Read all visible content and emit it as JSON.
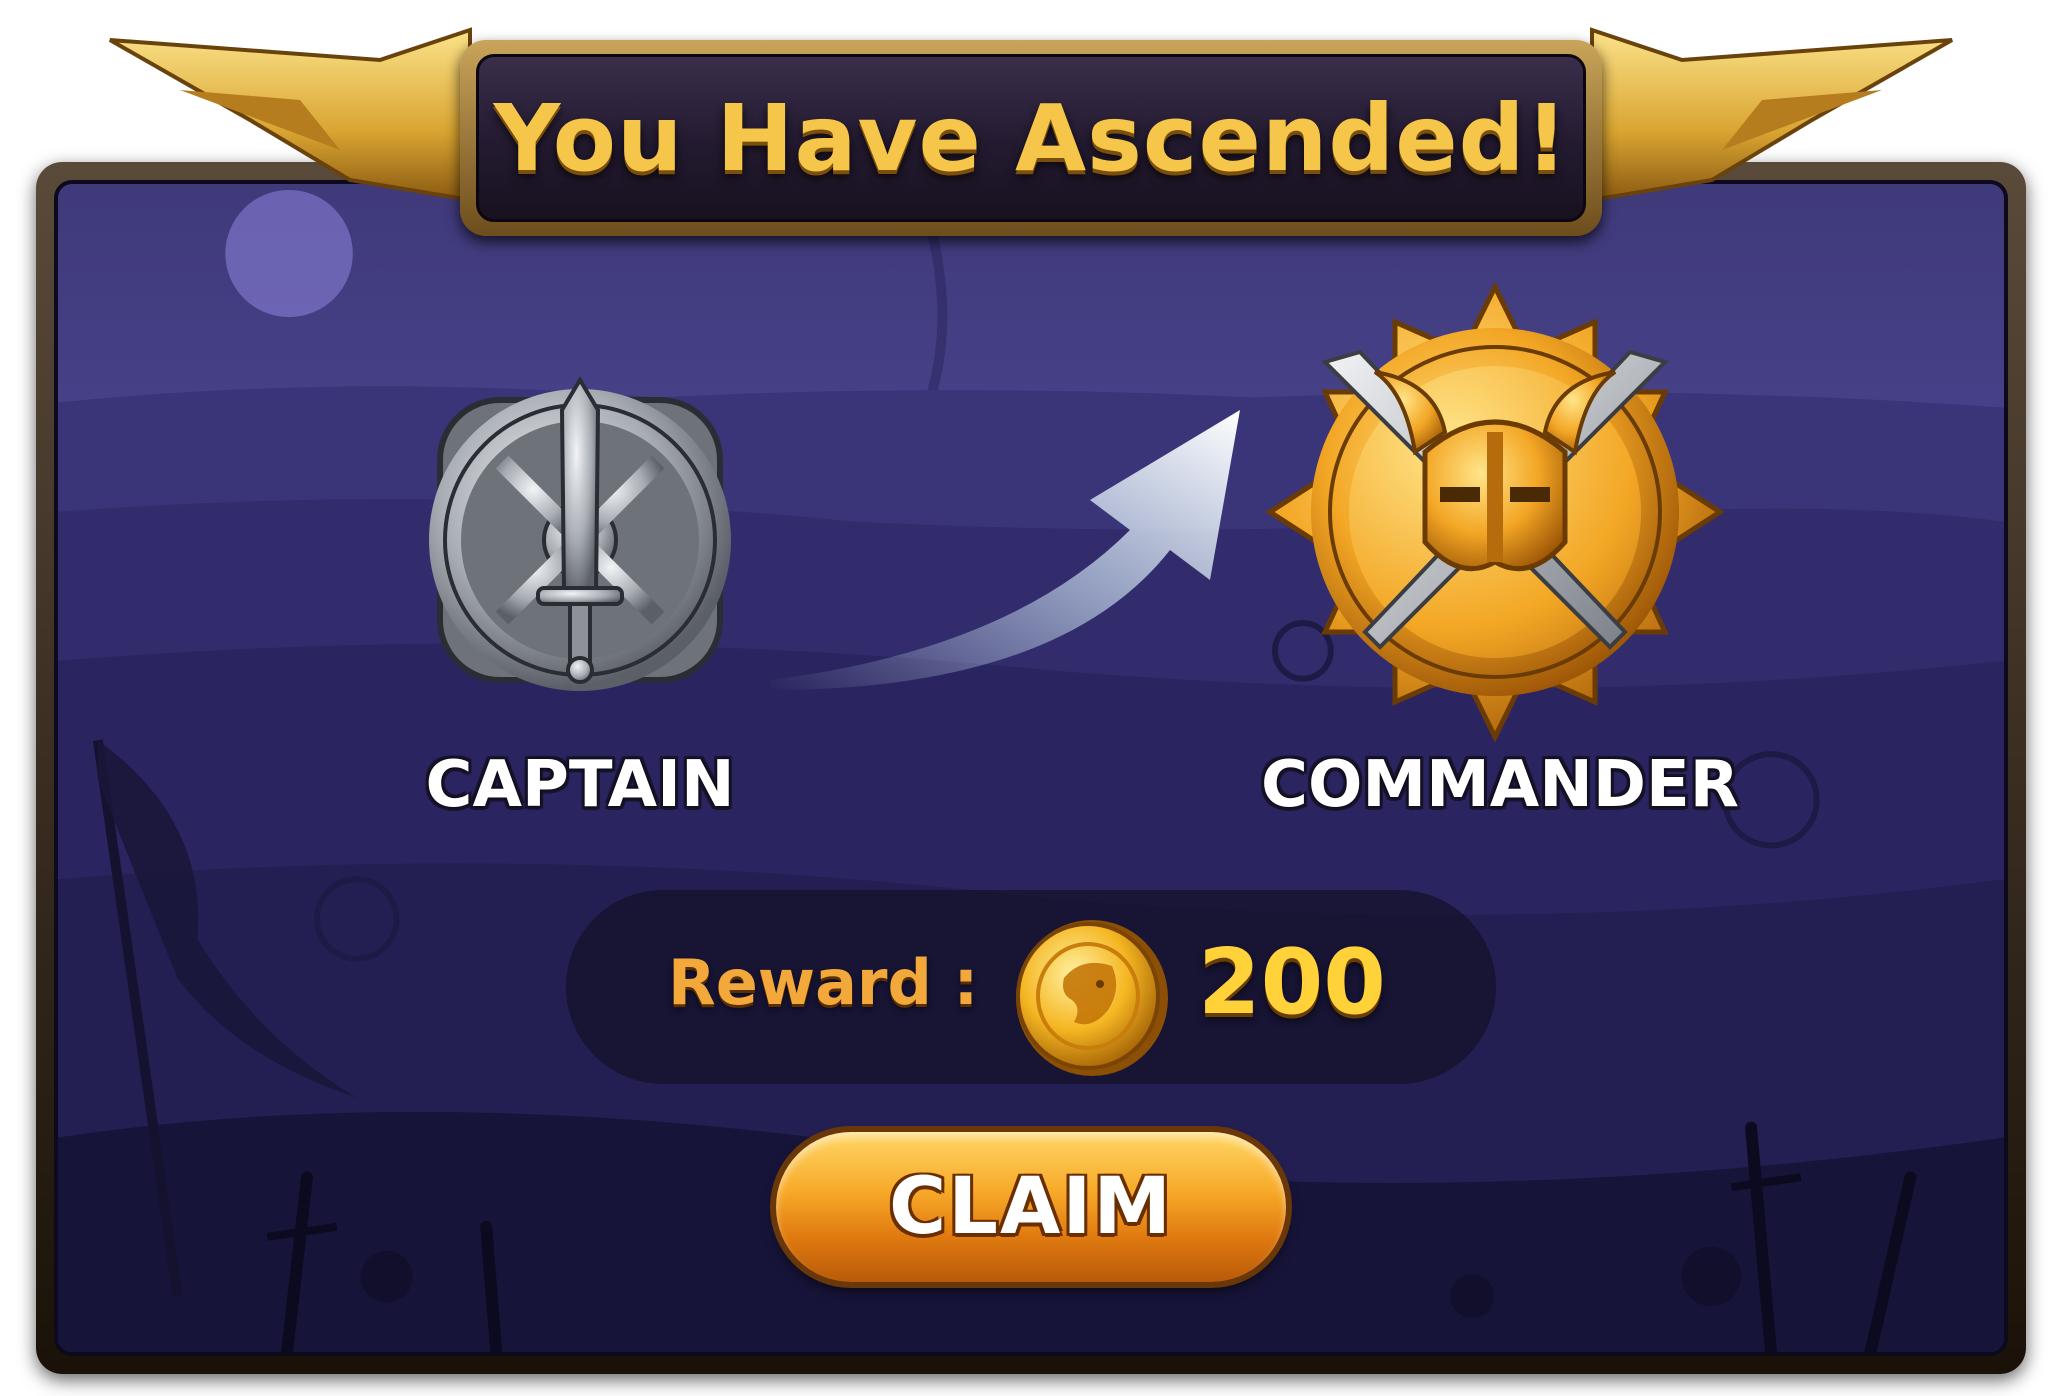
{
  "title": "You Have Ascended!",
  "ranks": {
    "from": {
      "label": "CAPTAIN",
      "icon": "silver-sword-wheel-badge-icon"
    },
    "to": {
      "label": "COMMANDER",
      "icon": "gold-horned-helmet-wheel-badge-icon"
    }
  },
  "reward": {
    "label": "Reward :",
    "amount": "200",
    "icon": "gold-lion-coin-icon"
  },
  "claim_button": {
    "label": "CLAIM"
  },
  "colors": {
    "title_text": "#f6c64a",
    "reward_label": "#f2a83a",
    "reward_amount": "#ffd23a",
    "panel_bg": "#4a4490",
    "button": "#f7a928"
  }
}
